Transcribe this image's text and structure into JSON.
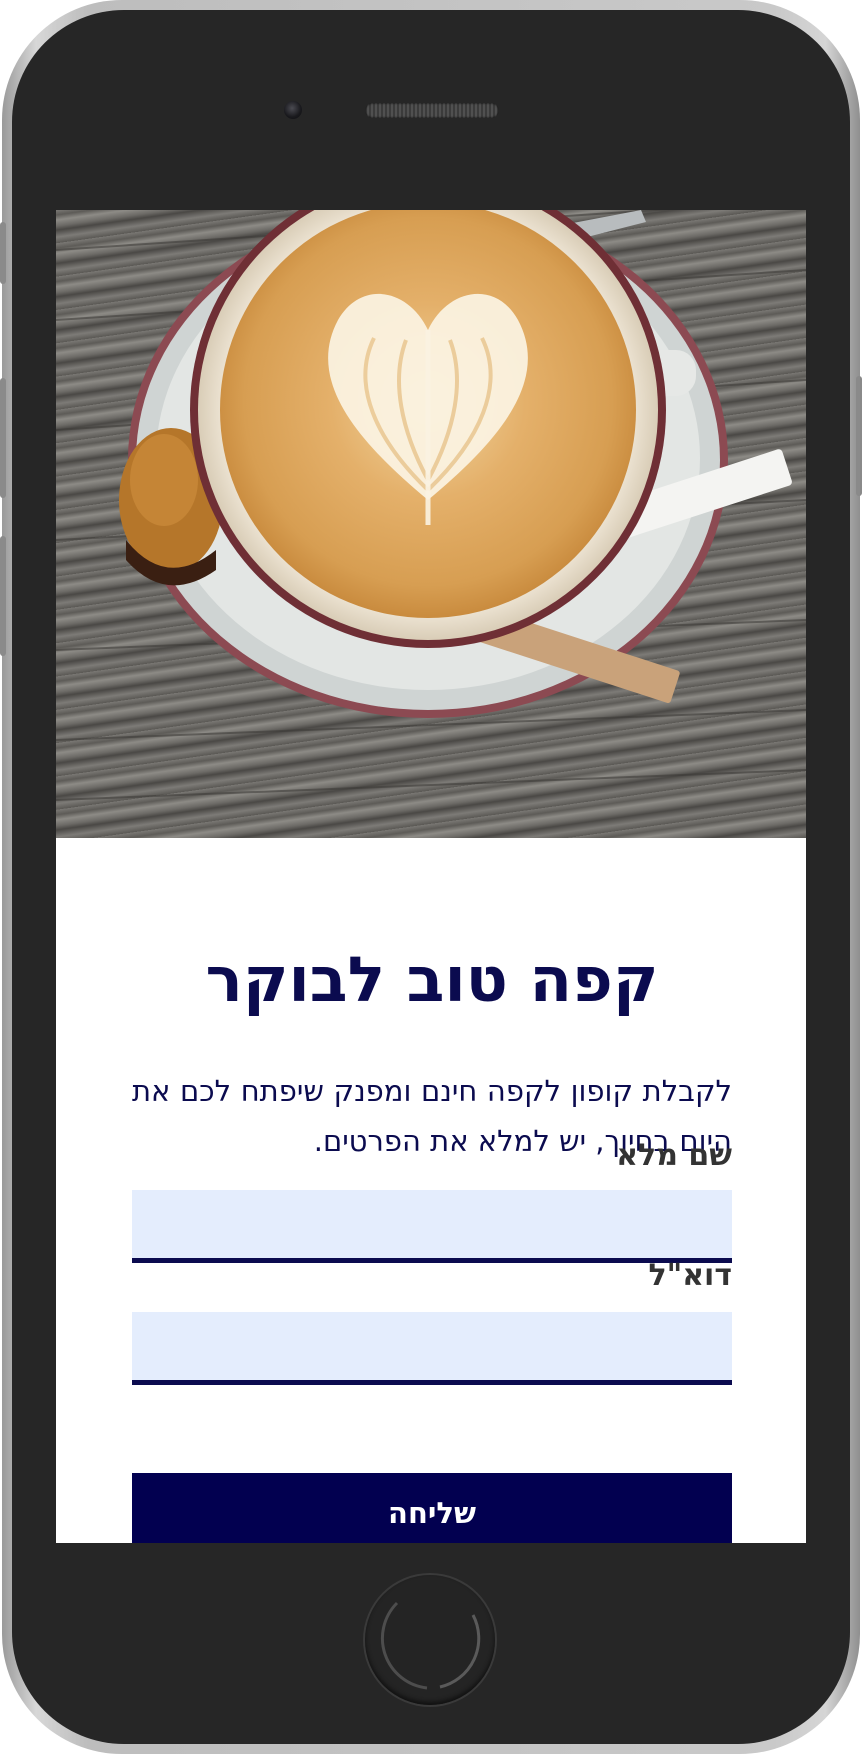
{
  "page": {
    "title": "קפה טוב לבוקר",
    "description": "לקבלת קופון לקפה חינם ומפנק שיפתח לכם את היום בחיוך, יש למלא את הפרטים."
  },
  "form": {
    "name_label": "שם מלא",
    "name_value": "",
    "email_label": "דוא\"ל",
    "email_value": "",
    "submit_label": "שליחה"
  },
  "colors": {
    "title": "#0b0b4f",
    "field_bg": "#e4edfd",
    "button_bg": "#020050",
    "phone_body": "#262626"
  },
  "icons": {
    "hero_image": "latte-art-coffee-cup-image"
  }
}
